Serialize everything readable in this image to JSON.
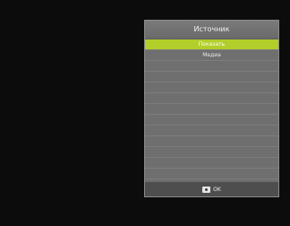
{
  "dialog": {
    "title": "Источник",
    "items": [
      {
        "label": "Показать",
        "selected": true
      },
      {
        "label": "Медиа",
        "selected": false
      },
      {
        "label": "",
        "selected": false
      },
      {
        "label": "",
        "selected": false
      },
      {
        "label": "",
        "selected": false
      },
      {
        "label": "",
        "selected": false
      },
      {
        "label": "",
        "selected": false
      },
      {
        "label": "",
        "selected": false
      },
      {
        "label": "",
        "selected": false
      },
      {
        "label": "",
        "selected": false
      },
      {
        "label": "",
        "selected": false
      },
      {
        "label": "",
        "selected": false
      },
      {
        "label": "",
        "selected": false
      }
    ],
    "footer": {
      "icon": "ok-button-icon",
      "label": "OK"
    }
  },
  "colors": {
    "background": "#0c0c0c",
    "panel": "#6f6f6f",
    "selected": "#b2ce2a",
    "footer": "#4e4e4e"
  }
}
